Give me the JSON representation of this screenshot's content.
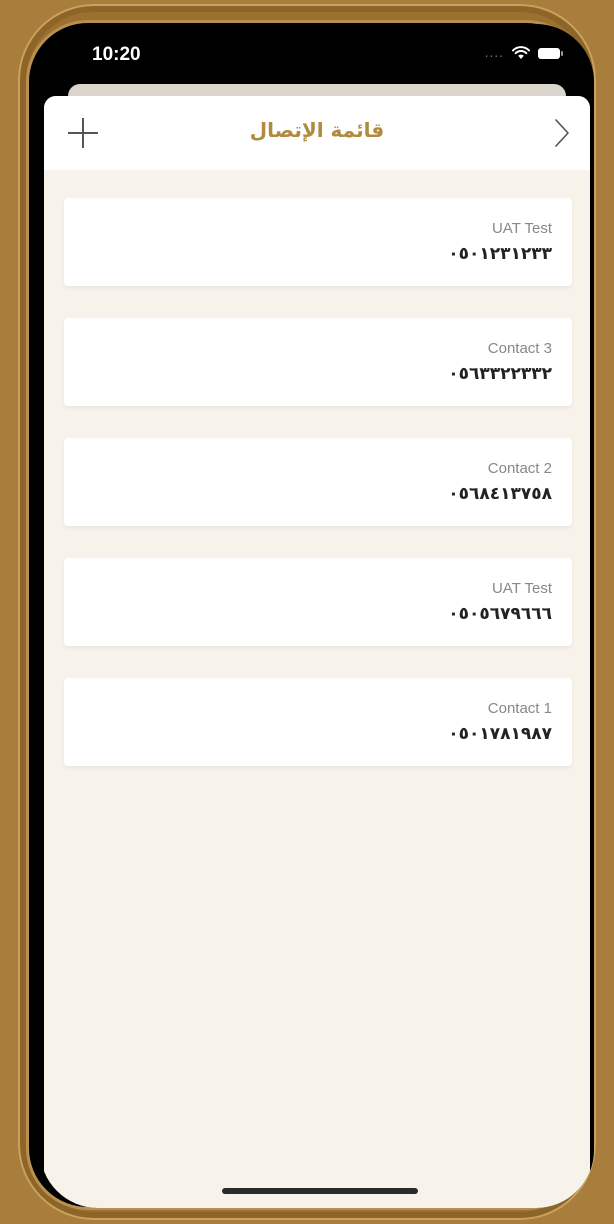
{
  "status_bar": {
    "time": "10:20",
    "signal": "....",
    "icons": [
      "wifi-icon",
      "battery-icon"
    ]
  },
  "nav": {
    "title": "قائمة الإتصال",
    "add_icon": "plus-icon",
    "back_icon": "chevron-right-icon"
  },
  "contacts": [
    {
      "name": "UAT Test",
      "phone": "٠٥٠١٢٣١٢٣٣"
    },
    {
      "name": "Contact 3",
      "phone": "٠٥٦٣٣٢٢٣٣٢"
    },
    {
      "name": "Contact 2",
      "phone": "٠٥٦٨٤١٣٧٥٨"
    },
    {
      "name": "UAT Test",
      "phone": "٠٥٠٥٦٧٩٦٦٦"
    },
    {
      "name": "Contact 1",
      "phone": "٠٥٠١٧٨١٩٨٧"
    }
  ],
  "colors": {
    "accent": "#b08a3e",
    "background": "#f7f2ea",
    "frame": "#a97d3c"
  }
}
